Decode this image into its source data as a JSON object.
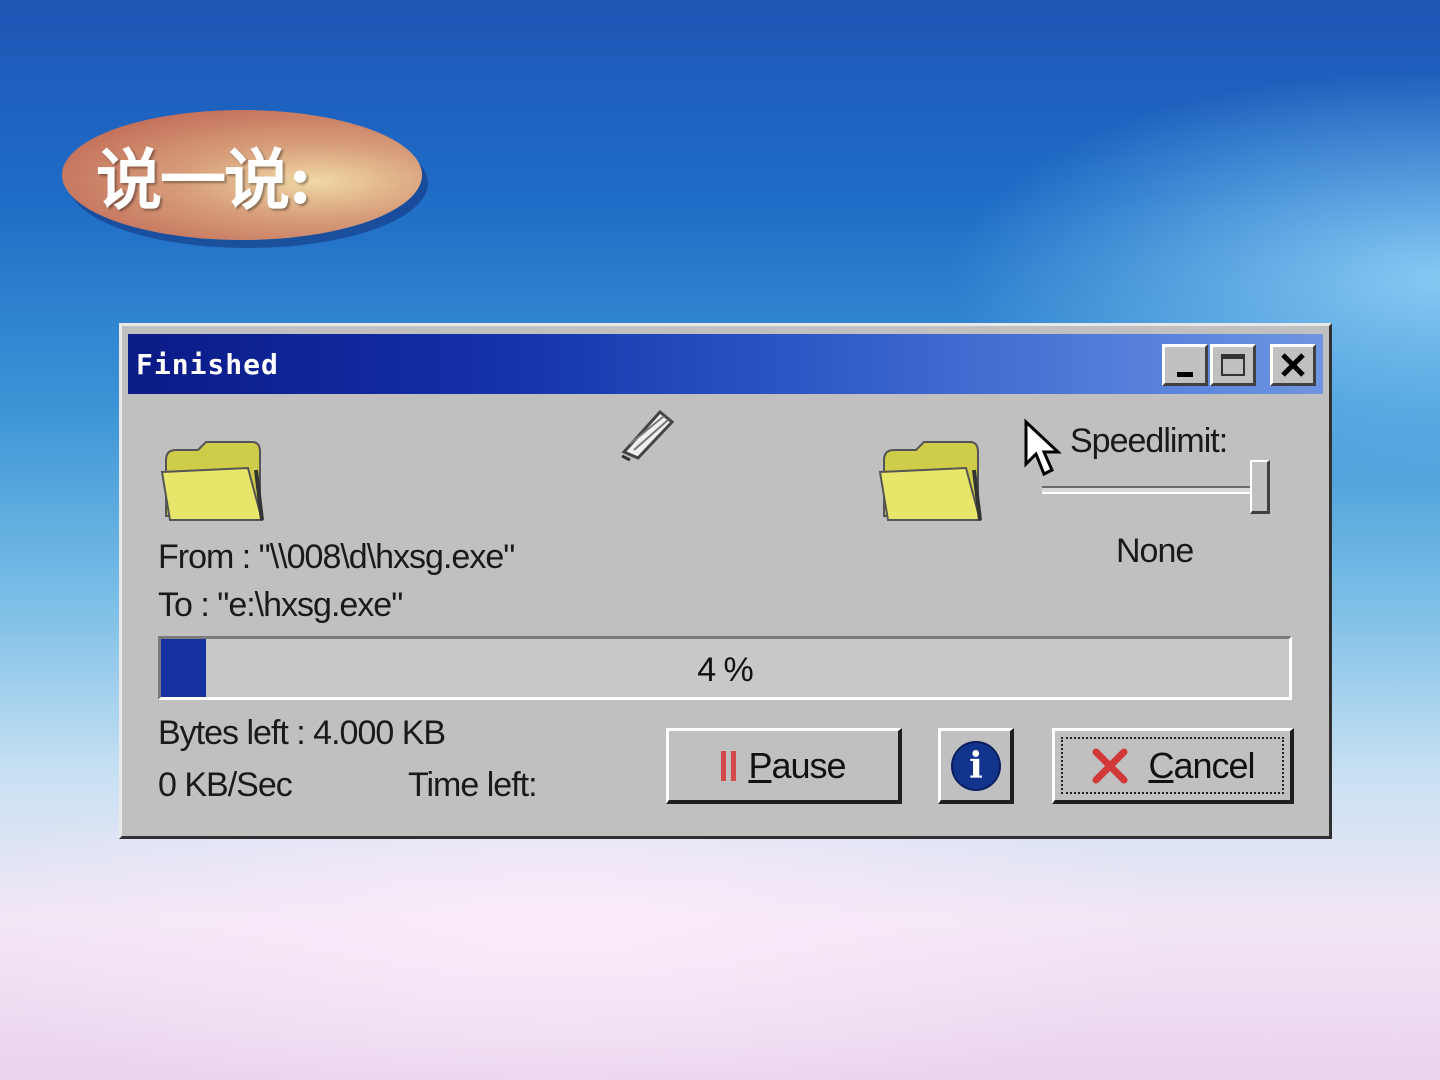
{
  "slide": {
    "heading": "说一说:"
  },
  "window": {
    "title": "Finished",
    "title_buttons": [
      "minimize-icon",
      "maximize-icon",
      "close-icon"
    ]
  },
  "transfer": {
    "from_text": "From : \"\\\\008\\d\\hxsg.exe\"",
    "to_text": "To     : \"e:\\hxsg.exe\"",
    "progress_label": "4 %",
    "progress_fraction": 0.04,
    "bytes_left": "Bytes left : 4.000 KB",
    "rate": "0 KB/Sec",
    "time_left": "Time left:"
  },
  "speedlimit": {
    "label": "Speedlimit:",
    "value": "None"
  },
  "buttons": {
    "pause_prefix": "",
    "pause_mnemonic": "P",
    "pause_rest": "ause",
    "info_glyph": "i",
    "cancel_mnemonic": "C",
    "cancel_rest": "ancel"
  },
  "icons": [
    "folder-icon",
    "pen-icon",
    "folder-icon",
    "cursor-icon",
    "pause-icon",
    "info-icon",
    "cancel-x-icon"
  ],
  "colors": {
    "titlebar_start": "#0a1a86",
    "titlebar_end": "#6f94e2",
    "window_face": "#c0c0c0",
    "folder_yellow": "#e8e66a",
    "cancel_red": "#d23838",
    "info_blue": "#13348c"
  }
}
